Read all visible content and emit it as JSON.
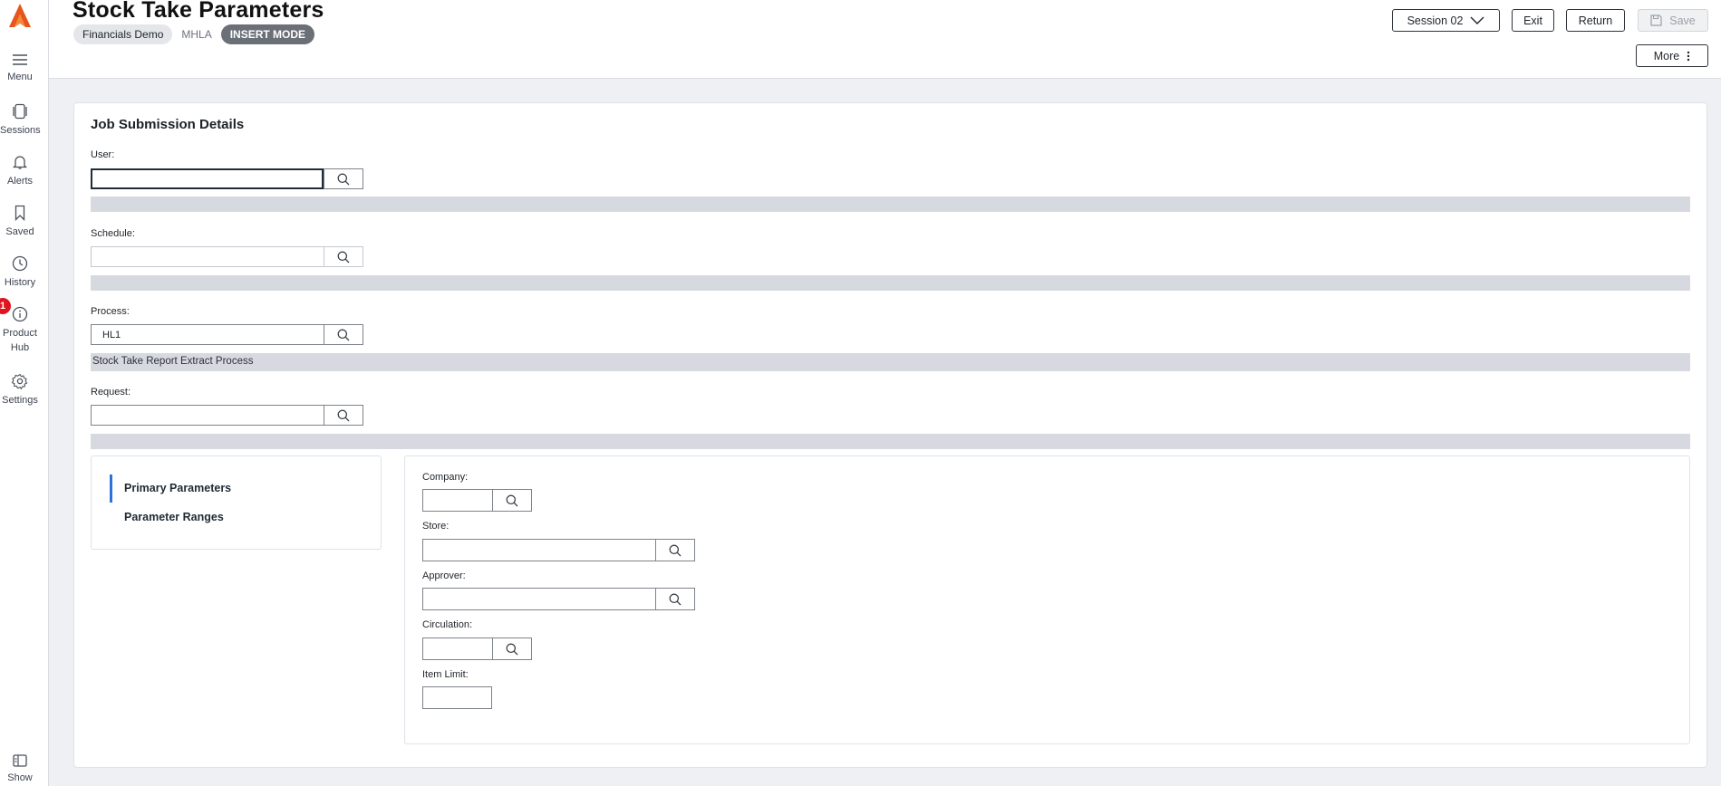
{
  "header": {
    "title": "Stock Take Parameters",
    "chips": [
      "Financials Demo",
      "MHLA",
      "INSERT MODE"
    ],
    "session_label": "Session 02",
    "exit_label": "Exit",
    "return_label": "Return",
    "save_label": "Save",
    "more_label": "More"
  },
  "rail": {
    "items": [
      {
        "label": "Menu",
        "icon": "hamburger-icon"
      },
      {
        "label": "Sessions",
        "icon": "sessions-icon"
      },
      {
        "label": "Alerts",
        "icon": "bell-icon"
      },
      {
        "label": "Saved",
        "icon": "bookmark-icon"
      },
      {
        "label": "History",
        "icon": "clock-icon"
      },
      {
        "label": "Product Hub",
        "icon": "info-icon",
        "badge": "1"
      },
      {
        "label": "Settings",
        "icon": "gear-icon"
      }
    ],
    "bottom": {
      "label": "Show",
      "icon": "show-panel-icon"
    }
  },
  "form": {
    "section_title": "Job Submission Details",
    "user": {
      "label": "User:",
      "value": ""
    },
    "schedule": {
      "label": "Schedule:",
      "value": ""
    },
    "process": {
      "label": "Process:",
      "value": "HL1",
      "description": "Stock Take Report Extract Process"
    },
    "request": {
      "label": "Request:",
      "value": ""
    }
  },
  "tabs": [
    "Primary Parameters",
    "Parameter Ranges"
  ],
  "params": {
    "company": {
      "label": "Company:",
      "value": ""
    },
    "store": {
      "label": "Store:",
      "value": ""
    },
    "approver": {
      "label": "Approver:",
      "value": ""
    },
    "circulation": {
      "label": "Circulation:",
      "value": ""
    },
    "item_limit": {
      "label": "Item Limit:",
      "value": ""
    }
  },
  "colors": {
    "accent": "#2a72d8",
    "brand": "#e8541c",
    "badge": "#e0141e"
  }
}
